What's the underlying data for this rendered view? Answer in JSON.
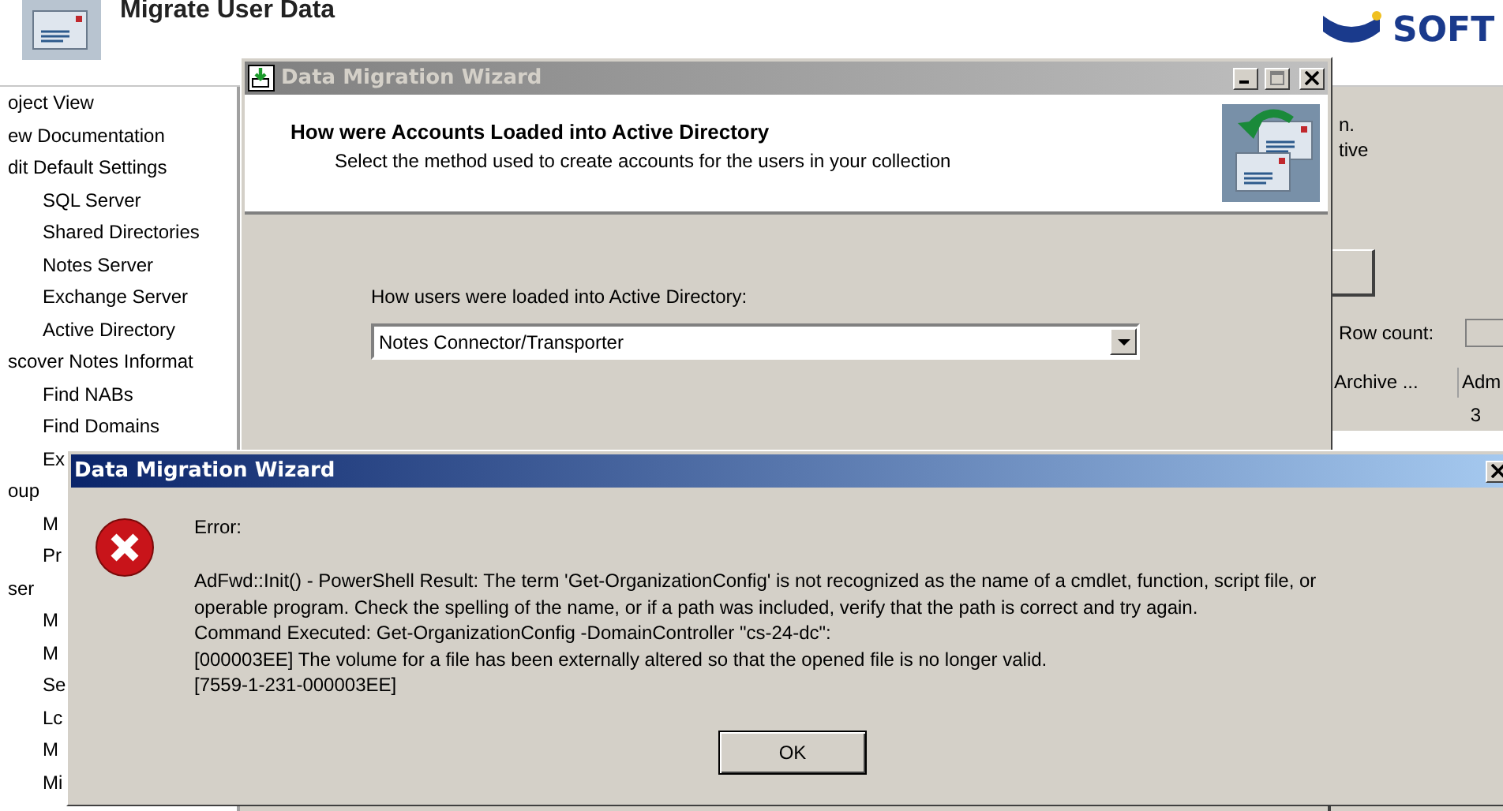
{
  "app": {
    "title": "Migrate User Data",
    "logo": "SOFT"
  },
  "sidebar": {
    "items": [
      {
        "label": "oject View"
      },
      {
        "label": "ew Documentation"
      },
      {
        "label": "dit Default Settings",
        "children": [
          {
            "label": "SQL Server"
          },
          {
            "label": "Shared Directories"
          },
          {
            "label": "Notes Server"
          },
          {
            "label": "Exchange Server"
          },
          {
            "label": "Active Directory"
          }
        ]
      },
      {
        "label": "scover Notes Informat",
        "children": [
          {
            "label": "Find NABs"
          },
          {
            "label": "Find Domains"
          },
          {
            "label": "Ex"
          }
        ]
      },
      {
        "label": "oup",
        "children": [
          {
            "label": "M"
          },
          {
            "label": "Pr"
          }
        ]
      },
      {
        "label": "ser",
        "children": [
          {
            "label": "M"
          },
          {
            "label": "M"
          },
          {
            "label": "Se"
          },
          {
            "label": "Lc"
          },
          {
            "label": "M"
          },
          {
            "label": "Mi"
          }
        ]
      }
    ]
  },
  "side_panel": {
    "texts": [
      "n.",
      "tive"
    ],
    "row_count_label": "Row count:",
    "table": {
      "columns": [
        "Archive ...",
        "Adm"
      ],
      "rows": [
        [
          "",
          "3"
        ]
      ]
    }
  },
  "wizard": {
    "title": "Data Migration Wizard",
    "active": false,
    "header_title": "How were Accounts Loaded into Active Directory",
    "header_subtitle": "Select the method used to create accounts for the users in your collection",
    "field_label": "How users were loaded into Active Directory:",
    "field_value": "Notes Connector/Transporter"
  },
  "error_dialog": {
    "title": "Data Migration Wizard",
    "active": true,
    "heading": "Error:",
    "message": [
      "AdFwd::Init() - PowerShell Result: The term 'Get-OrganizationConfig' is not recognized as the name of a cmdlet, function, script file, or",
      "operable program. Check the spelling of the name, or if a path was included, verify that the path is correct and try again.",
      "Command Executed: Get-OrganizationConfig -DomainController \"cs-24-dc\":",
      "[000003EE] The volume for a file has been externally altered so that the opened file is no longer valid.",
      "[7559-1-231-000003EE]"
    ],
    "button": "OK"
  }
}
